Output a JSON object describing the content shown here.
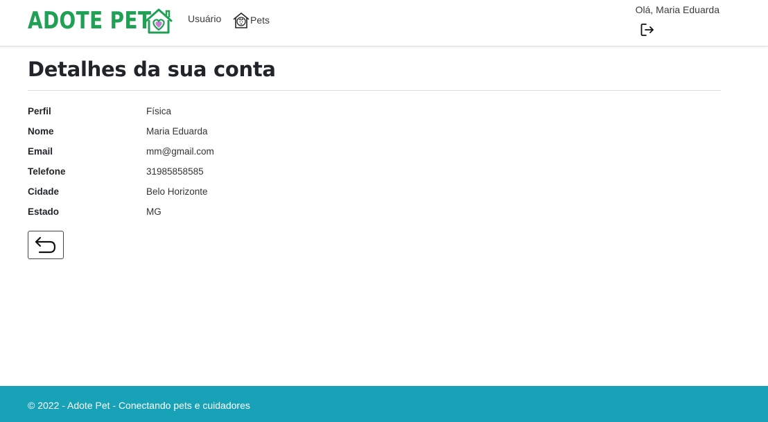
{
  "header": {
    "brand": {
      "text": "ADOTE PET",
      "color": "#1fa055",
      "heart_color": "#c77dd0"
    },
    "nav": {
      "usuario_label": "Usuário",
      "pets_label": "Pets"
    },
    "greeting": "Olá, Maria Eduarda"
  },
  "main": {
    "title": "Detalhes da sua conta",
    "fields": [
      {
        "label": "Perfil",
        "value": "Física"
      },
      {
        "label": "Nome",
        "value": "Maria Eduarda"
      },
      {
        "label": "Email",
        "value": "mm@gmail.com"
      },
      {
        "label": "Telefone",
        "value": "31985858585"
      },
      {
        "label": "Cidade",
        "value": "Belo Horizonte"
      },
      {
        "label": "Estado",
        "value": "MG"
      }
    ]
  },
  "icons": {
    "pets": "pet-house-icon",
    "logout": "logout-icon",
    "back": "return-arrow-icon"
  },
  "footer": {
    "text": "© 2022 - Adote Pet - Conectando pets e cuidadores",
    "background": "#17a2b8"
  }
}
